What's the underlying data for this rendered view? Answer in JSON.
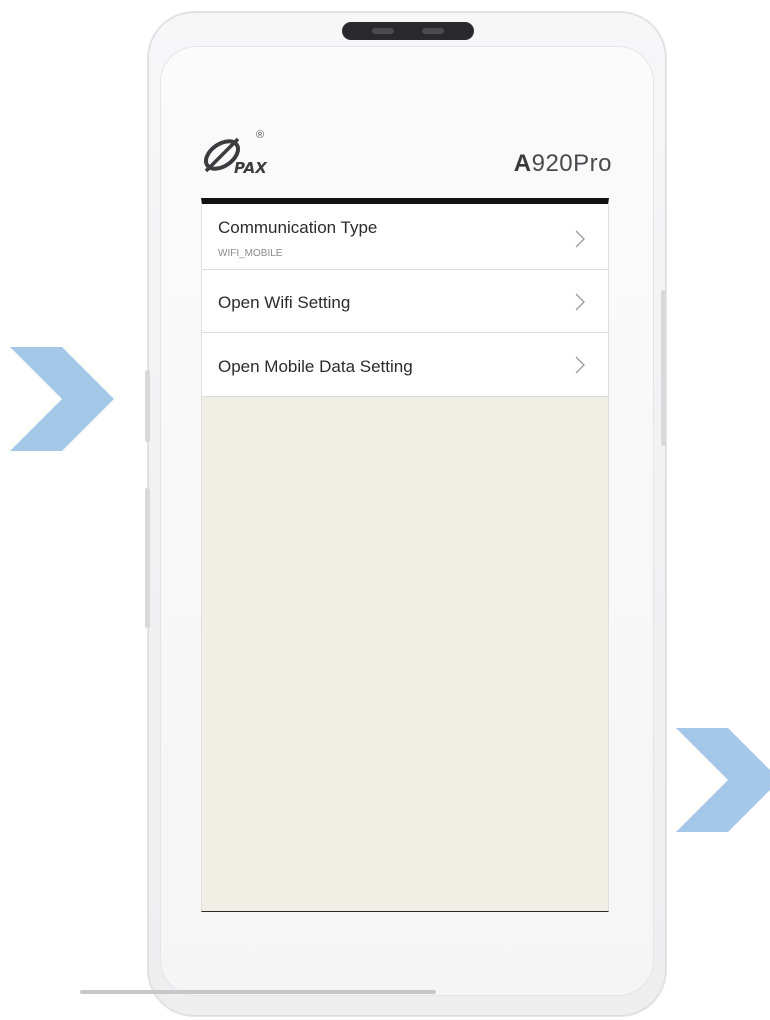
{
  "device": {
    "brand": "PAX",
    "registered_mark": "®",
    "model_prefix": "A",
    "model_suffix": "920Pro"
  },
  "settings": {
    "items": [
      {
        "title": "Communication Type",
        "subtitle": "WIFI_MOBILE",
        "icon": "chevron-right-icon"
      },
      {
        "title": "Open Wifi Setting",
        "icon": "chevron-right-icon"
      },
      {
        "title": "Open Mobile Data Setting",
        "icon": "chevron-right-icon"
      }
    ]
  },
  "annotations": {
    "arrow_color": "#a6c8e8",
    "icon": "chevron-right-icon"
  },
  "colors": {
    "screen_background": "#efefe6",
    "list_background": "#ffffff",
    "top_bar": "#111111"
  }
}
